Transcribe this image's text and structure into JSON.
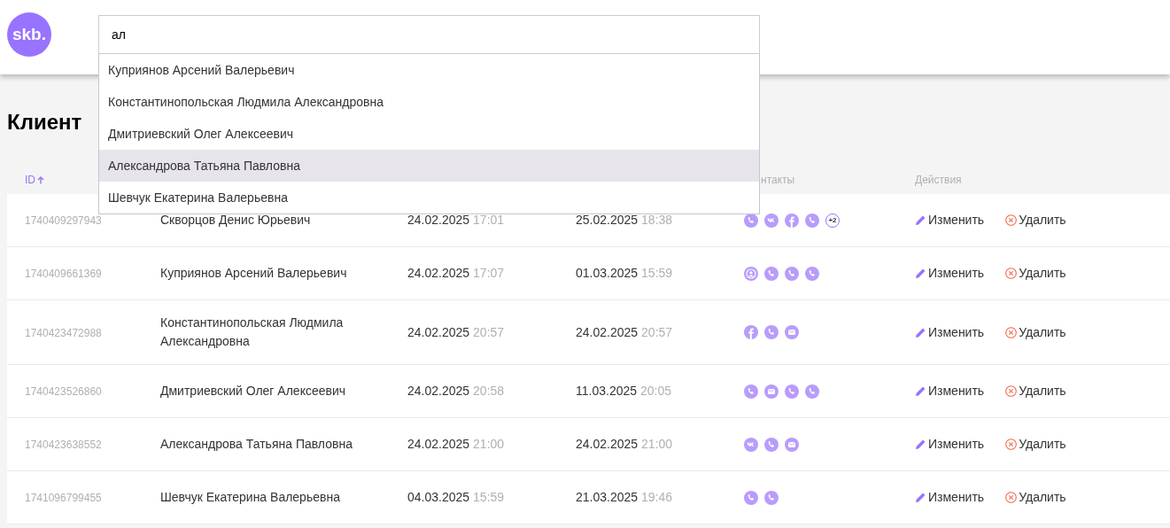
{
  "logo": "skb.",
  "search": {
    "value": "ал",
    "suggestions": [
      {
        "label": "Куприянов Арсений Валерьевич",
        "selected": false
      },
      {
        "label": "Константинопольская Людмила Александровна",
        "selected": false
      },
      {
        "label": "Дмитриевский Олег Алексеевич",
        "selected": false
      },
      {
        "label": "Александрова Татьяна Павловна",
        "selected": true
      },
      {
        "label": "Шевчук Екатерина Валерьевна",
        "selected": false
      }
    ]
  },
  "page_title": "Клиент",
  "table": {
    "columns": [
      {
        "kind": "id",
        "label": "ID",
        "sorted": true
      },
      {
        "kind": "contacts",
        "label": "нтакты",
        "sorted": false
      },
      {
        "kind": "actions",
        "label": "Действия",
        "sorted": false
      }
    ],
    "rows": [
      {
        "id": "1740409297943",
        "name": "Скворцов Денис Юрьевич",
        "created_date": "24.02.2025",
        "created_time": "17:01",
        "changed_date": "25.02.2025",
        "changed_time": "18:38",
        "contacts": [
          {
            "kind": "phone"
          },
          {
            "kind": "vk"
          },
          {
            "kind": "facebook"
          },
          {
            "kind": "phone"
          },
          {
            "kind": "more",
            "label": "+2"
          }
        ],
        "edit": "Изменить",
        "delete": "Удалить"
      },
      {
        "id": "1740409661369",
        "name": "Куприянов Арсений Валерьевич",
        "created_date": "24.02.2025",
        "created_time": "17:07",
        "changed_date": "01.03.2025",
        "changed_time": "15:59",
        "contacts": [
          {
            "kind": "person"
          },
          {
            "kind": "phone"
          },
          {
            "kind": "phone"
          },
          {
            "kind": "phone"
          }
        ],
        "edit": "Изменить",
        "delete": "Удалить"
      },
      {
        "id": "1740423472988",
        "name": "Константинопольская Людмила Александровна",
        "created_date": "24.02.2025",
        "created_time": "20:57",
        "changed_date": "24.02.2025",
        "changed_time": "20:57",
        "contacts": [
          {
            "kind": "facebook"
          },
          {
            "kind": "phone"
          },
          {
            "kind": "email"
          }
        ],
        "edit": "Изменить",
        "delete": "Удалить"
      },
      {
        "id": "1740423526860",
        "name": "Дмитриевский Олег Алексеевич",
        "created_date": "24.02.2025",
        "created_time": "20:58",
        "changed_date": "11.03.2025",
        "changed_time": "20:05",
        "contacts": [
          {
            "kind": "phone"
          },
          {
            "kind": "email"
          },
          {
            "kind": "phone"
          },
          {
            "kind": "phone"
          }
        ],
        "edit": "Изменить",
        "delete": "Удалить"
      },
      {
        "id": "1740423638552",
        "name": "Александрова Татьяна Павловна",
        "created_date": "24.02.2025",
        "created_time": "21:00",
        "changed_date": "24.02.2025",
        "changed_time": "21:00",
        "contacts": [
          {
            "kind": "vk"
          },
          {
            "kind": "phone"
          },
          {
            "kind": "email"
          }
        ],
        "edit": "Изменить",
        "delete": "Удалить"
      },
      {
        "id": "1741096799455",
        "name": "Шевчук Екатерина Валерьевна",
        "created_date": "04.03.2025",
        "created_time": "15:59",
        "changed_date": "21.03.2025",
        "changed_time": "19:46",
        "contacts": [
          {
            "kind": "phone"
          },
          {
            "kind": "phone"
          }
        ],
        "edit": "Изменить",
        "delete": "Удалить"
      }
    ]
  }
}
